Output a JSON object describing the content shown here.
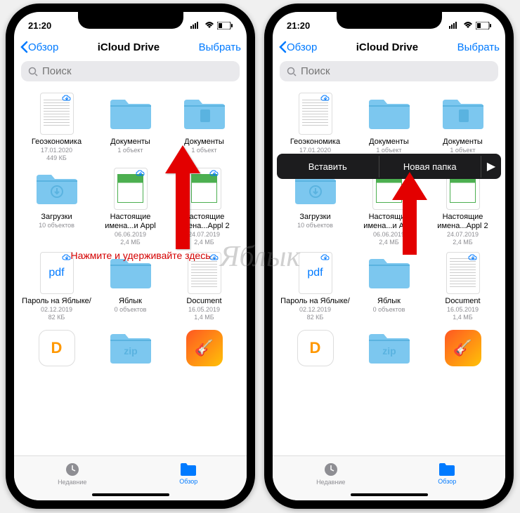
{
  "status": {
    "time": "21:20"
  },
  "nav": {
    "back": "Обзор",
    "title": "iCloud Drive",
    "select": "Выбрать"
  },
  "search": {
    "placeholder": "Поиск"
  },
  "items": [
    {
      "name": "Геоэкономика",
      "date": "17.01.2020",
      "size": "449 КБ",
      "type": "doc"
    },
    {
      "name": "Документы",
      "meta": "1 объект",
      "type": "folder"
    },
    {
      "name": "Документы",
      "meta": "1 объект",
      "type": "folder-doc"
    },
    {
      "name": "Загрузки",
      "meta": "10 объектов",
      "type": "folder-dl"
    },
    {
      "name": "Настоящие имена...и Appl",
      "date": "06.06.2019",
      "size": "2,4 МБ",
      "type": "doc-green"
    },
    {
      "name": "Настоящие имена...Appl 2",
      "date": "24.07.2019",
      "size": "2,4 МБ",
      "type": "doc-green"
    },
    {
      "name": "Пароль на Яблыке/",
      "date": "02.12.2019",
      "size": "82 КБ",
      "type": "pdf"
    },
    {
      "name": "Яблык",
      "meta": "0 объектов",
      "type": "folder"
    },
    {
      "name": "Document",
      "date": "16.05.2019",
      "size": "1,4 МБ",
      "type": "doc"
    },
    {
      "name": "",
      "meta": "",
      "type": "app-d"
    },
    {
      "name": "",
      "meta": "",
      "type": "folder-zip"
    },
    {
      "name": "",
      "meta": "",
      "type": "app-gb"
    }
  ],
  "tabs": {
    "recent": "Недавние",
    "browse": "Обзор"
  },
  "context_menu": {
    "paste": "Вставить",
    "new_folder": "Новая папка"
  },
  "annotation": {
    "left": "Нажмите и удерживайте\nздесь"
  },
  "watermark": "Яблык"
}
